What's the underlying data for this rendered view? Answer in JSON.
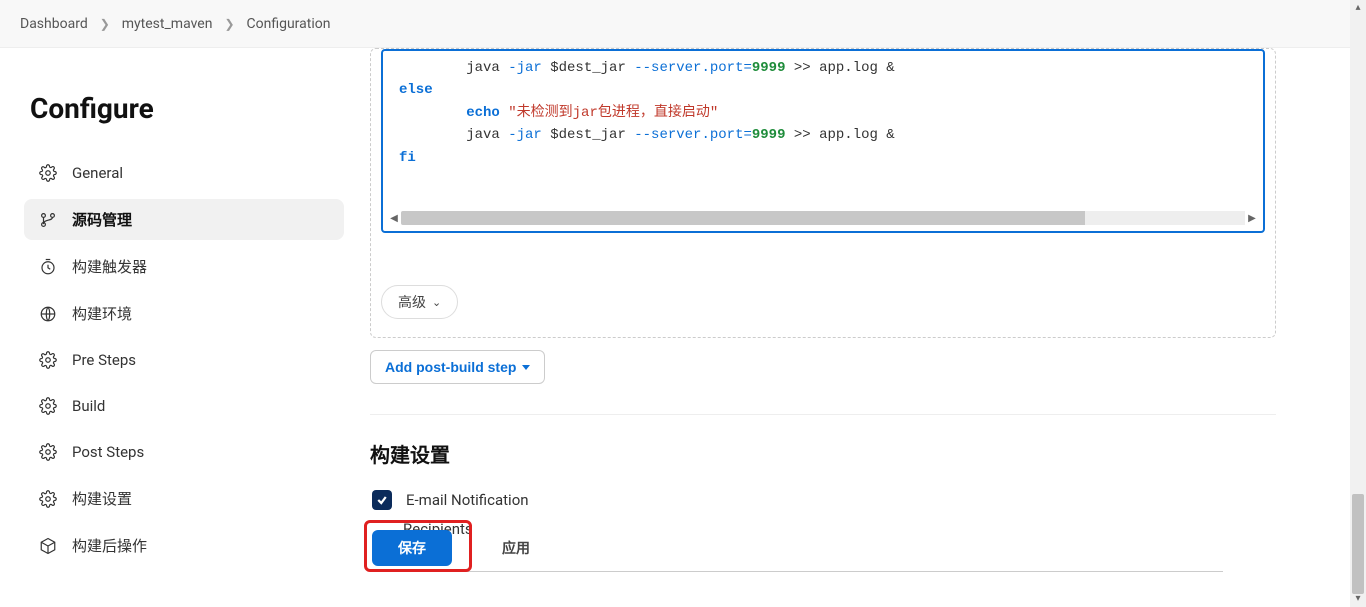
{
  "breadcrumbs": [
    "Dashboard",
    "mytest_maven",
    "Configuration"
  ],
  "pageTitle": "Configure",
  "sidebar": {
    "items": [
      {
        "label": "General",
        "icon": "gear"
      },
      {
        "label": "源码管理",
        "icon": "branch",
        "active": true
      },
      {
        "label": "构建触发器",
        "icon": "clock"
      },
      {
        "label": "构建环境",
        "icon": "globe"
      },
      {
        "label": "Pre Steps",
        "icon": "gear"
      },
      {
        "label": "Build",
        "icon": "gear"
      },
      {
        "label": "Post Steps",
        "icon": "gear"
      },
      {
        "label": "构建设置",
        "icon": "gear"
      },
      {
        "label": "构建后操作",
        "icon": "cube"
      }
    ]
  },
  "code": {
    "lines": [
      {
        "indent": 2,
        "parts": [
          [
            "plain",
            "java "
          ],
          [
            "flag",
            "-jar"
          ],
          [
            "plain",
            " $dest_jar "
          ],
          [
            "flag",
            "--server.port="
          ],
          [
            "num",
            "9999"
          ],
          [
            "plain",
            " >> app.log &"
          ]
        ]
      },
      {
        "indent": 0,
        "parts": [
          [
            "kw",
            "else"
          ]
        ]
      },
      {
        "indent": 2,
        "parts": [
          [
            "kw",
            "echo"
          ],
          [
            "plain",
            " "
          ],
          [
            "str",
            "\"未检测到jar包进程，直接启动\""
          ]
        ]
      },
      {
        "indent": 2,
        "parts": [
          [
            "plain",
            "java "
          ],
          [
            "flag",
            "-jar"
          ],
          [
            "plain",
            " $dest_jar "
          ],
          [
            "flag",
            "--server.port="
          ],
          [
            "num",
            "9999"
          ],
          [
            "plain",
            " >> app.log &"
          ]
        ]
      },
      {
        "indent": 0,
        "parts": [
          [
            "kw",
            "fi"
          ]
        ]
      }
    ]
  },
  "advancedLabel": "高级",
  "addPostBuildLabel": "Add post-build step",
  "buildSettingsTitle": "构建设置",
  "emailNotification": {
    "label": "E-mail Notification",
    "checked": true,
    "recipientsLabel": "Recipients"
  },
  "buttons": {
    "save": "保存",
    "apply": "应用"
  }
}
